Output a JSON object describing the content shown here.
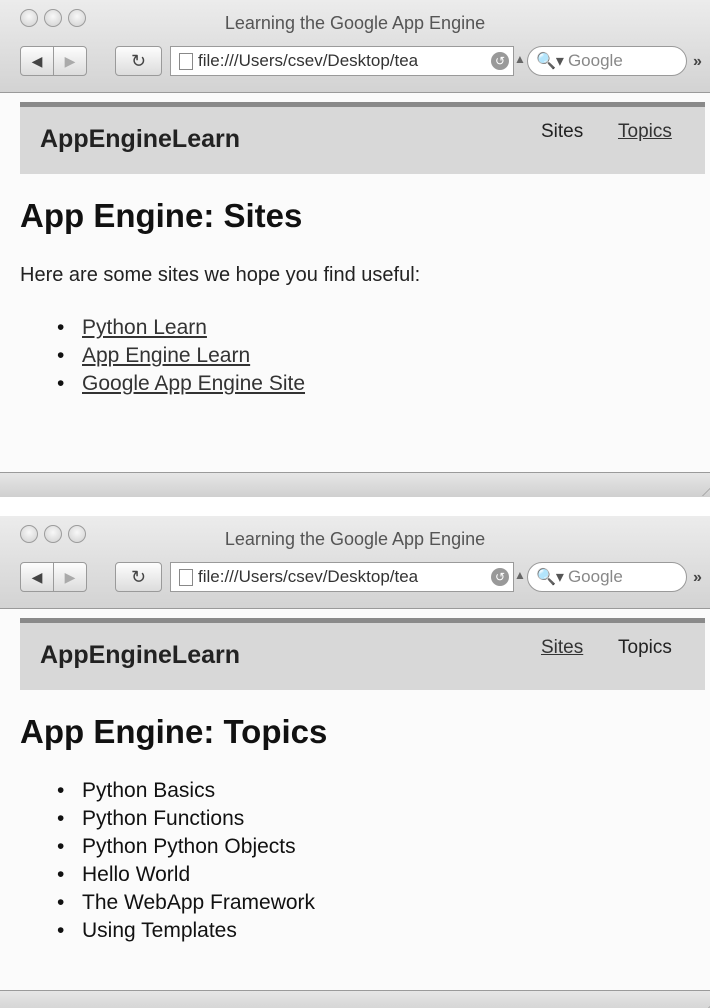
{
  "windows": [
    {
      "title": "Learning the Google App Engine",
      "url": "file:///Users/csev/Desktop/tea",
      "search_placeholder": "Google",
      "brand": "AppEngineLearn",
      "nav": [
        {
          "label": "Sites",
          "active": false
        },
        {
          "label": "Topics",
          "active": true
        }
      ],
      "heading": "App Engine: Sites",
      "intro": "Here are some sites we hope you find useful:",
      "items": [
        "Python Learn",
        "App Engine Learn",
        "Google App Engine Site"
      ]
    },
    {
      "title": "Learning the Google App Engine",
      "url": "file:///Users/csev/Desktop/tea",
      "search_placeholder": "Google",
      "brand": "AppEngineLearn",
      "nav": [
        {
          "label": "Sites",
          "active": true
        },
        {
          "label": "Topics",
          "active": false
        }
      ],
      "heading": "App Engine: Topics",
      "items": [
        "Python Basics",
        "Python Functions",
        "Python Python Objects",
        "Hello World",
        "The WebApp Framework",
        "Using Templates"
      ]
    }
  ]
}
